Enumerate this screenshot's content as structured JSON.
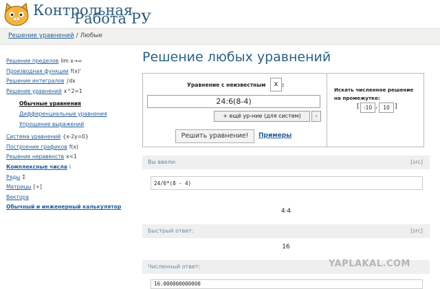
{
  "header": {
    "brand_line1": "Контрольная",
    "brand_line2": "Работа РУ"
  },
  "breadcrumb": {
    "link": "Решение уравнений",
    "sep": "/",
    "current": "Любые"
  },
  "sidebar": {
    "items": [
      {
        "label": "Решение пределов",
        "suffix": "lim x→∞"
      },
      {
        "label": "Производная функции",
        "suffix": "f(x)'"
      },
      {
        "label": "Решение интегралов",
        "suffix": "∫dx"
      },
      {
        "label": "Решение уравнений",
        "suffix": "x^2=1"
      }
    ],
    "sub_items": [
      {
        "label": "Обычные уравнения"
      },
      {
        "label": "Дифференциальные уравнения"
      },
      {
        "label": "Упрощение выражений"
      }
    ],
    "items2": [
      {
        "label": "Система уравнений",
        "suffix": "{x-2y=0}"
      },
      {
        "label": "Построение графиков",
        "suffix": "f(x)"
      },
      {
        "label": "Решение неравенств",
        "suffix": "x<1"
      },
      {
        "label": "Комплексные числа",
        "suffix": "i"
      },
      {
        "label": "Ряды",
        "suffix": "Σ"
      },
      {
        "label": "Матрицы",
        "suffix": "[÷]"
      },
      {
        "label": "Вектора",
        "suffix": ""
      },
      {
        "label": "Обычный и инженерный калькулятор",
        "suffix": ""
      }
    ]
  },
  "main": {
    "title": "Решение любых уравнений",
    "eq_label": "Уравнение с неизвестным",
    "variable": "x",
    "colon": ":",
    "equation": "24:6(8-4)",
    "add_button": "+ ещё ур-ние (для систем)",
    "remove_button": "-",
    "solve_button": "Решить уравнение!",
    "examples_link": "Примеры"
  },
  "range": {
    "label": "Искать численное решение на промежутке:",
    "from": "-10",
    "to": "10",
    "open": "[",
    "comma": ",",
    "close": "]"
  },
  "results": {
    "input_head": "Вы ввели:",
    "src": "[src]",
    "input_code": "24/6*(8 - 4)",
    "input_pretty": "4·4",
    "quick_head": "Быстрый ответ:",
    "quick_value": "16",
    "numeric_head": "Численный ответ:",
    "numeric_value": "16.000000000000"
  },
  "watermark": "YAPLAKAL.COM",
  "colors": {
    "accent": "#2b6288",
    "link": "#1f5c99"
  }
}
